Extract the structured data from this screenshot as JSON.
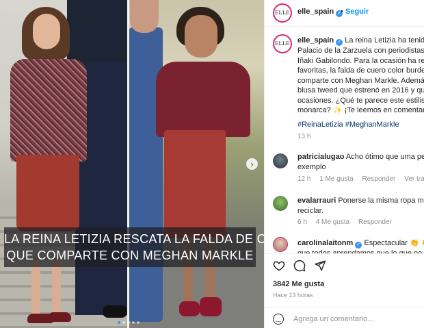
{
  "post_image": {
    "caption_overlay": {
      "line1": "LA REINA LETIZIA RESCATA LA FALDA DE CUERO",
      "line2": "QUE COMPARTE CON MEGHAN MARKLE"
    },
    "next_icon": "chevron-right-icon",
    "carousel_dots": 5,
    "active_dot": 1
  },
  "header": {
    "avatar_text": "ELLE",
    "username": "elle_spain",
    "separator": "•",
    "follow_label": "Seguir"
  },
  "caption": {
    "username": "elle_spain",
    "lines": [
      "La reina Letizia ha tenido d",
      "Palacio de la Zarzuela con periodistas co",
      "Iñaki Gabilondo. Para la ocasión ha resca",
      "favoritas, la falda de cuero color burdeo",
      "comparte con Meghan Markle. Además,",
      "blusa tweed que estrenó en 2016 y que",
      "ocasiones. ¿Qué te parece este estilismo",
      "monarca? ✨ ¡Te leemos en comentarios"
    ],
    "hashtags": "#ReinaLetizia #MeghanMarkle",
    "time": "13 h"
  },
  "comments": [
    {
      "username": "patricialugao",
      "text_lines": [
        "Acho ótimo que uma pess",
        "exemplo"
      ],
      "time": "12 h",
      "likes": "1 Me gusta",
      "reply": "Responder",
      "translate": "Ver traducció"
    },
    {
      "username": "evalarrauri",
      "text_lines": [
        "Ponerse la misma ropa más c",
        "reciclar."
      ],
      "time": "6 h",
      "likes": "4 Me gusta",
      "reply": "Responder"
    },
    {
      "username": "carolinalaitonm",
      "text_lines": [
        "Espectacular 👏 👏 👏",
        "que todos aprendamos que lo que no c"
      ]
    }
  ],
  "actions": {
    "like_icon": "heart-icon",
    "comment_icon": "comment-icon",
    "share_icon": "share-icon",
    "likes_count": "3842 Me gusta",
    "posted_ago": "Hace 13 horas"
  },
  "add_comment": {
    "emoji_icon": "emoji-icon",
    "placeholder": "Agrega un comentario..."
  },
  "colors": {
    "accent_blue": "#0095f6",
    "link_dark": "#00376b",
    "muted": "#8e8e8e"
  }
}
